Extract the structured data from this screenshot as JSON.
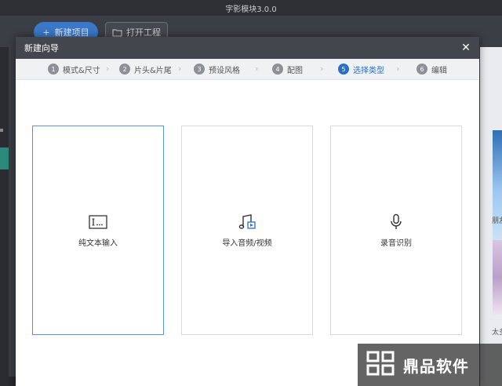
{
  "app": {
    "title": "字影模块3.0.0",
    "new_project_label": "新建项目",
    "open_project_label": "打开工程",
    "thumb_labels": [
      "朋友圈",
      "太多"
    ]
  },
  "dialog": {
    "title": "新建向导",
    "steps": [
      {
        "num": "1",
        "label": "模式&尺寸",
        "active": false
      },
      {
        "num": "2",
        "label": "片头&片尾",
        "active": false
      },
      {
        "num": "3",
        "label": "预设风格",
        "active": false
      },
      {
        "num": "4",
        "label": "配图",
        "active": false
      },
      {
        "num": "5",
        "label": "选择类型",
        "active": true
      },
      {
        "num": "6",
        "label": "编辑",
        "active": false
      }
    ],
    "options": [
      {
        "label": "纯文本输入",
        "icon": "text-input-icon",
        "selected": true
      },
      {
        "label": "导入音频/视频",
        "icon": "music-video-icon",
        "selected": false
      },
      {
        "label": "录音识别",
        "icon": "microphone-icon",
        "selected": false
      }
    ]
  },
  "watermark": {
    "text": "鼎品软件"
  },
  "colors": {
    "accent": "#2a6fc4",
    "titlebar": "#43464d"
  }
}
